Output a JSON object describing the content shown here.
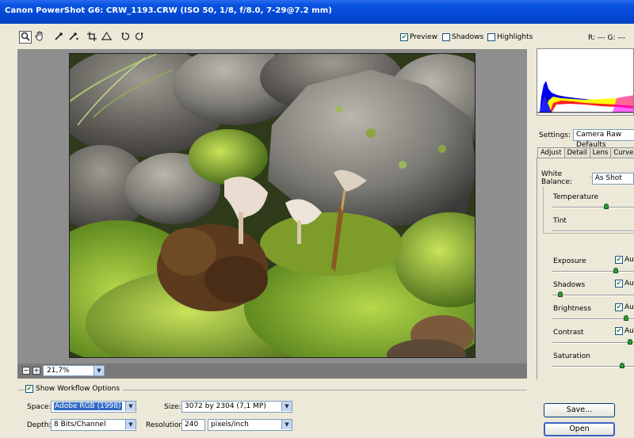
{
  "window": {
    "title": "Canon PowerShot G6:  CRW_1193.CRW  (ISO 50, 1/8, f/8.0, 7-29@7.2 mm)"
  },
  "tools": [
    {
      "name": "zoom-tool",
      "icon": "magnifier-icon",
      "glyph": "🔍"
    },
    {
      "name": "hand-tool",
      "icon": "hand-icon",
      "glyph": "✋"
    },
    {
      "name": "white-balance-tool",
      "icon": "eyedropper-icon",
      "glyph": "⁄"
    },
    {
      "name": "color-sampler-tool",
      "icon": "color-sampler-icon",
      "glyph": "⁄"
    },
    {
      "name": "crop-tool",
      "icon": "crop-icon",
      "glyph": "⌗"
    },
    {
      "name": "straighten-tool",
      "icon": "straighten-icon",
      "glyph": "△"
    },
    {
      "name": "rotate-left-tool",
      "icon": "rotate-left-icon",
      "glyph": "↺"
    },
    {
      "name": "rotate-right-tool",
      "icon": "rotate-right-icon",
      "glyph": "↻"
    }
  ],
  "view_options": {
    "preview_label": "Preview",
    "preview_checked": true,
    "shadows_label": "Shadows",
    "shadows_checked": false,
    "highlights_label": "Highlights",
    "highlights_checked": false
  },
  "readout": {
    "text": "R: ---   G: ---"
  },
  "zoom": {
    "minus": "−",
    "plus": "+",
    "value": "21,7%"
  },
  "workflow": {
    "label": "Show Workflow Options",
    "checked": true,
    "space_label": "Space:",
    "space_value": "Adobe RGB (1998)",
    "depth_label": "Depth:",
    "depth_value": "8 Bits/Channel",
    "size_label": "Size:",
    "size_value": "3072 by 2304  (7,1 MP)",
    "resolution_label": "Resolution:",
    "resolution_value": "240",
    "resolution_unit": "pixels/inch"
  },
  "settings": {
    "label": "Settings:",
    "value": "Camera Raw Defaults"
  },
  "tabs": [
    "Adjust",
    "Detail",
    "Lens",
    "Curve"
  ],
  "adjust": {
    "white_balance_label": "White Balance:",
    "white_balance_value": "As Shot",
    "sliders": [
      {
        "label": "Temperature",
        "level": 0.66,
        "auto": null
      },
      {
        "label": "Tint",
        "level": null,
        "auto": null
      },
      {
        "label": "Exposure",
        "level": 0.78,
        "auto": "Auto"
      },
      {
        "label": "Shadows",
        "level": 0.1,
        "auto": "Auto"
      },
      {
        "label": "Brightness",
        "level": 0.9,
        "auto": "Auto"
      },
      {
        "label": "Contrast",
        "level": 0.95,
        "auto": "Auto"
      },
      {
        "label": "Saturation",
        "level": 0.85,
        "auto": null
      }
    ]
  },
  "buttons": {
    "save": "Save...",
    "open": "Open"
  },
  "colors": {
    "accent": "#316ac5",
    "thumb": "#2c9a3a",
    "titlebar": "#0448d6"
  }
}
